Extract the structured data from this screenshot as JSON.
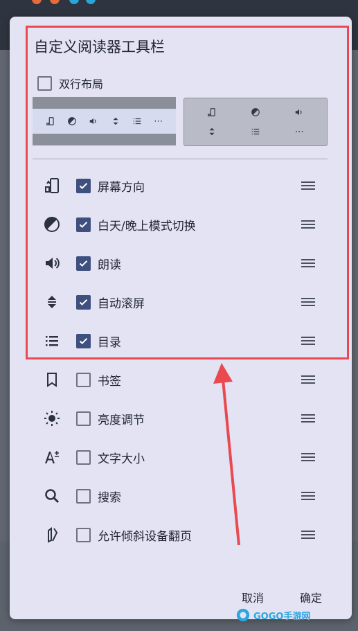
{
  "dialog": {
    "title": "自定义阅读器工具栏",
    "dual_row_label": "双行布局",
    "dual_row_checked": false
  },
  "toolbar_items": [
    {
      "label": "屏幕方向",
      "icon": "screen-rotation-icon",
      "checked": true
    },
    {
      "label": "白天/晚上模式切换",
      "icon": "day-night-icon",
      "checked": true
    },
    {
      "label": "朗读",
      "icon": "volume-icon",
      "checked": true
    },
    {
      "label": "自动滚屏",
      "icon": "auto-scroll-icon",
      "checked": true
    },
    {
      "label": "目录",
      "icon": "list-icon",
      "checked": true
    },
    {
      "label": "书签",
      "icon": "bookmark-icon",
      "checked": false
    },
    {
      "label": "亮度调节",
      "icon": "brightness-icon",
      "checked": false
    },
    {
      "label": "文字大小",
      "icon": "text-size-icon",
      "checked": false
    },
    {
      "label": "搜索",
      "icon": "search-icon",
      "checked": false
    },
    {
      "label": "允许倾斜设备翻页",
      "icon": "tilt-page-icon",
      "checked": false
    }
  ],
  "buttons": {
    "cancel": "取消",
    "confirm": "确定"
  },
  "watermark": {
    "text": "GOGO手游网"
  },
  "colors": {
    "dialog_bg": "#e3e3f3",
    "checkbox_checked": "#3f4f7e",
    "highlight_border": "#e9494f"
  }
}
